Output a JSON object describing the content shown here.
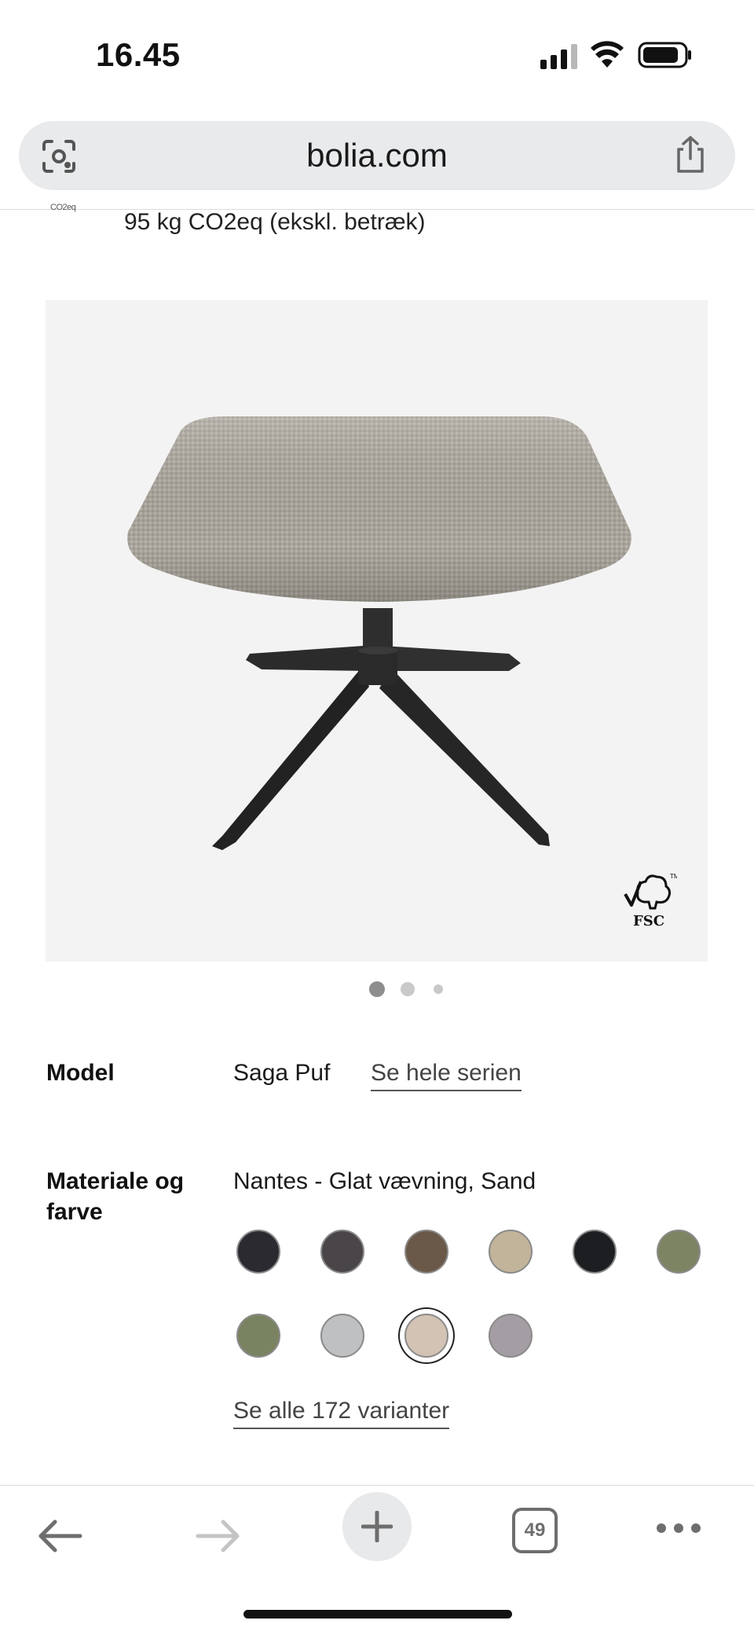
{
  "status_bar": {
    "time": "16.45",
    "signal_icon": "cellular-signal-icon",
    "wifi_icon": "wifi-icon",
    "battery_icon": "battery-icon"
  },
  "browser": {
    "url": "bolia.com",
    "lens_icon": "visual-search-icon",
    "share_icon": "share-icon"
  },
  "co2": {
    "icon_text": "CO2eq",
    "text": "95 kg CO2eq (ekskl. betræk)"
  },
  "product_image": {
    "alt_subject": "footstool",
    "fsc_label": "FSC",
    "background": "#f3f3f3"
  },
  "carousel": {
    "total": 3,
    "active_index": 0
  },
  "specs": {
    "model_label": "Model",
    "model_value": "Saga Puf",
    "series_link": "Se hele serien",
    "material_label": "Materiale og farve",
    "material_value": "Nantes - Glat vævning, Sand",
    "swatches": [
      {
        "color": "#2c2a31",
        "selected": false
      },
      {
        "color": "#4a4548",
        "selected": false
      },
      {
        "color": "#6a5848",
        "selected": false
      },
      {
        "color": "#c2b49a",
        "selected": false
      },
      {
        "color": "#1c1e21",
        "selected": false
      },
      {
        "color": "#7d8463",
        "selected": false
      },
      {
        "color": "#7a8361",
        "selected": false
      },
      {
        "color": "#bfc0c2",
        "selected": false
      },
      {
        "color": "#d3c3b4",
        "selected": true
      },
      {
        "color": "#a49ea4",
        "selected": false
      }
    ],
    "variants_link": "Se alle 172 varianter"
  },
  "toolbar": {
    "back_icon": "back-arrow-icon",
    "forward_icon": "forward-arrow-icon",
    "new_tab_icon": "plus-icon",
    "tab_count": "49",
    "more_icon": "more-dots-icon"
  }
}
